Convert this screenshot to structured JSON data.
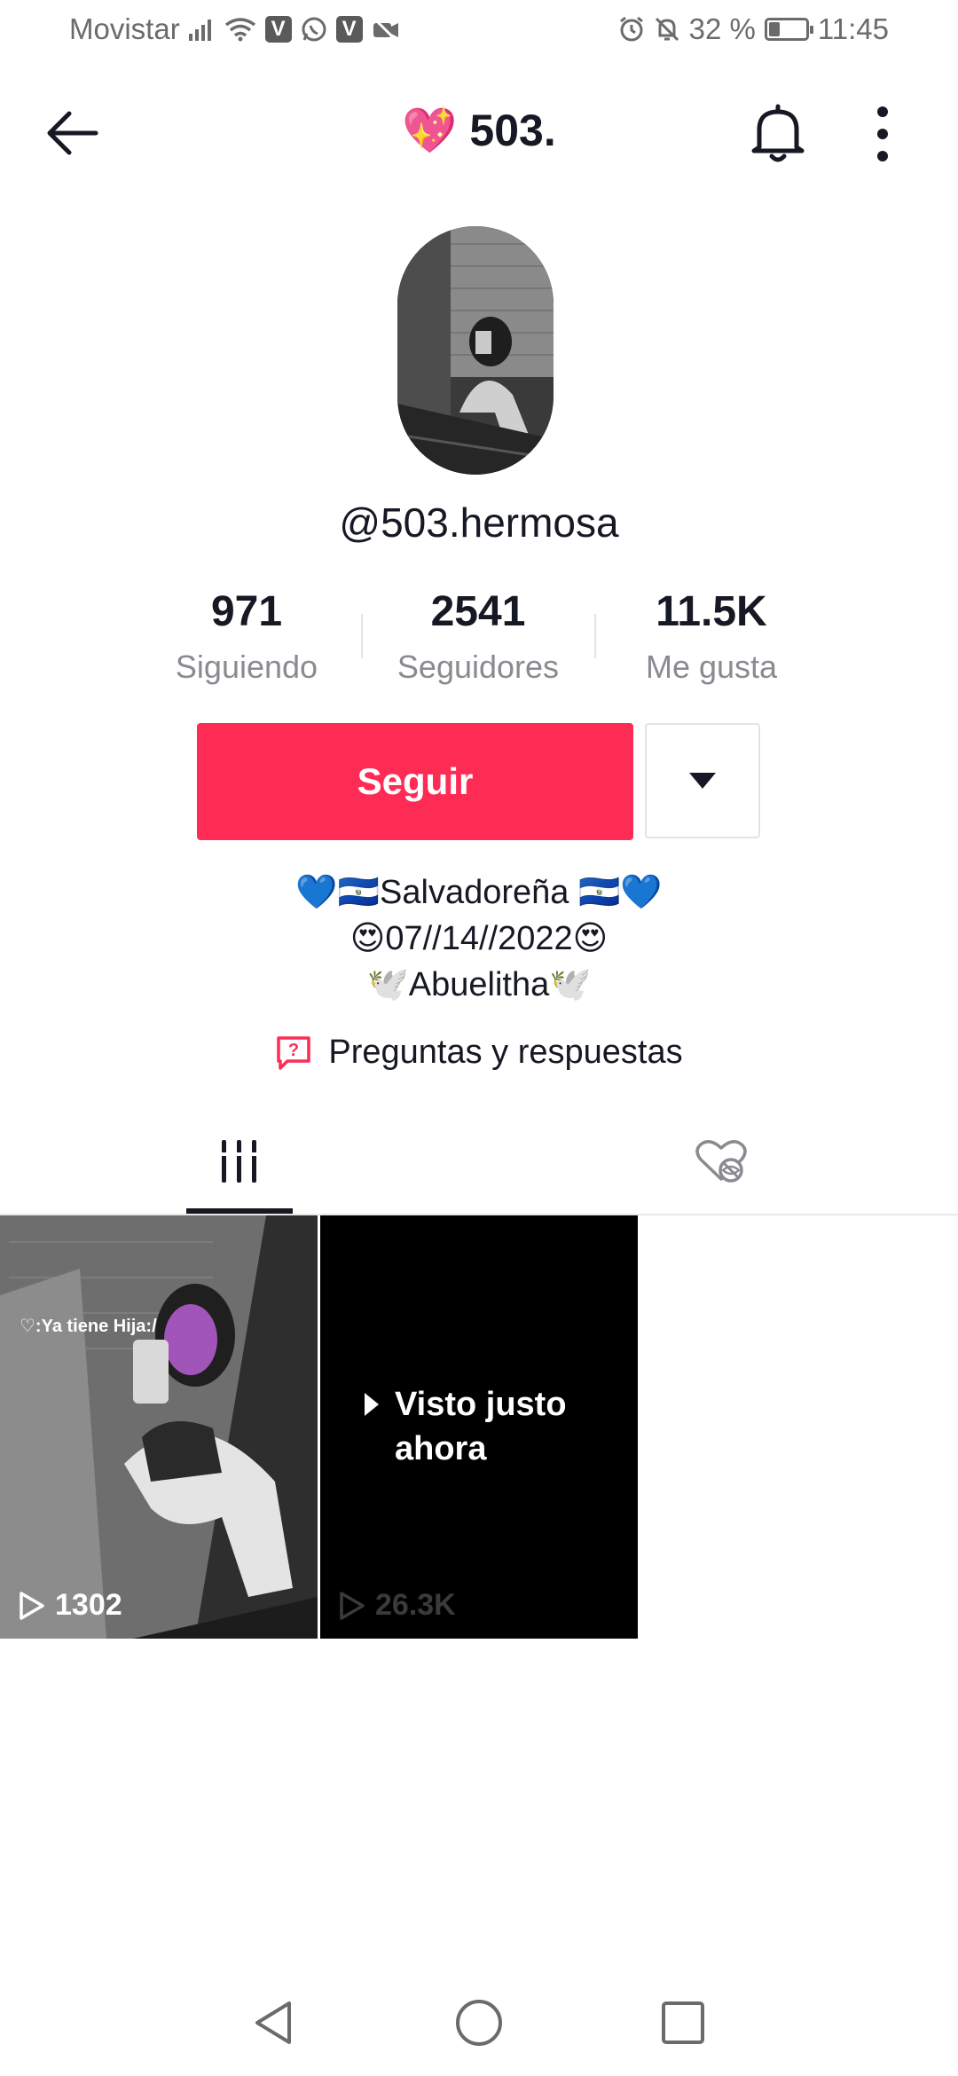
{
  "status_bar": {
    "carrier": "Movistar",
    "battery_percent": "32 %",
    "time": "11:45",
    "icons": [
      "signal-icon",
      "wifi-icon",
      "viber-icon",
      "whatsapp-icon",
      "viber-icon",
      "camera-off-icon",
      "alarm-icon",
      "mute-icon",
      "battery-icon"
    ]
  },
  "header": {
    "title": "💖 503.",
    "icons": [
      "back-arrow-icon",
      "bell-icon",
      "more-vertical-icon"
    ]
  },
  "profile": {
    "username": "@503.hermosa",
    "stats": [
      {
        "value": "971",
        "label": "Siguiendo"
      },
      {
        "value": "2541",
        "label": "Seguidores"
      },
      {
        "value": "11.5K",
        "label": "Me gusta"
      }
    ],
    "follow_label": "Seguir",
    "bio": [
      "💙🇸🇻Salvadoreña 🇸🇻💙",
      "😍07//14//2022😍",
      "🕊️Abuelitha🕊️"
    ],
    "qa_label": "Preguntas y respuestas"
  },
  "tabs": {
    "icons": [
      "videos-grid-icon",
      "liked-hidden-icon"
    ],
    "active": 0
  },
  "videos": [
    {
      "caption": "♡:Ya tiene Hija:/",
      "views": "1302"
    },
    {
      "overlay": "Visto justo ahora",
      "views": "26.3K"
    }
  ],
  "navbar": {
    "icons": [
      "nav-back-icon",
      "nav-home-icon",
      "nav-recents-icon"
    ]
  },
  "colors": {
    "accent": "#fe2c55",
    "text": "#161823",
    "secondary_text": "#8a8b91"
  }
}
